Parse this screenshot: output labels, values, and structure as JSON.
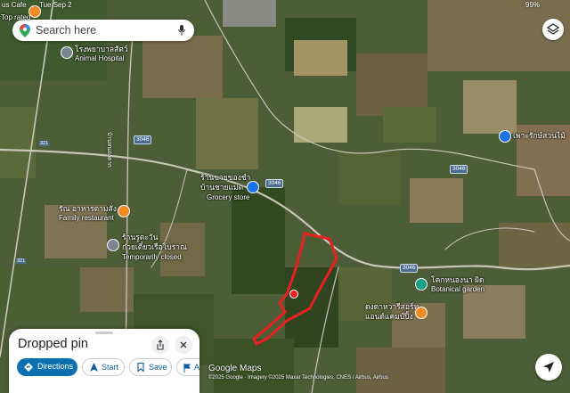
{
  "status_bar": {
    "left": "us Cafe",
    "datetime": "Tue Sep 2",
    "right_indicator": "99%"
  },
  "search": {
    "placeholder": "Search here"
  },
  "pois": {
    "top_rated": "Top rated",
    "hospital_th": "โรงพยาบาลสัตว์",
    "hospital_en": "Animal Hospital",
    "grocery_th_1": "ร้านขายของชำ",
    "grocery_th_2": "บ้านชายแม่ต",
    "grocery_en": "Grocery store",
    "restaurant_th": "รัณ อาหารตามสั่ง",
    "restaurant_en": "Family restaurant",
    "closed_th_1": "ร้านรูตะวัน",
    "closed_th_2": "ก๋วยเตี๋ยวเรือโบราณ",
    "closed_en": "Temporarily closed",
    "temple_th": "เพาะรักษ์สวนไม้",
    "garden_th": "โคกหนองนา ผิด",
    "garden_en": "Botanical garden",
    "cafe_th_1": "ดงดาหวารีสอร์ท",
    "cafe_th_2": "แอนด์แคมป์ปิ้ง"
  },
  "road_labels": {
    "vertical_road": "บ้านหนองตาก",
    "route_3046_a": "3046",
    "route_3046_b": "3046",
    "route_3046_c": "3046",
    "route_3046_d": "3046",
    "route_321_a": "321",
    "route_321_b": "321"
  },
  "bottom_sheet": {
    "title": "Dropped pin",
    "directions": "Directions",
    "start": "Start",
    "save": "Save",
    "more": "A"
  },
  "watermark": "Google Maps",
  "attribution": "©2025 Google · Imagery ©2025 Maxar Technologies, CNES / Airbus, Airbus",
  "colors": {
    "boundary": "#e8201f",
    "primary_button": "#0b6fb0",
    "poi_blue": "#1a73e8",
    "poi_orange": "#f28b22",
    "poi_grey": "#7d868f",
    "poi_green": "#16a085"
  }
}
